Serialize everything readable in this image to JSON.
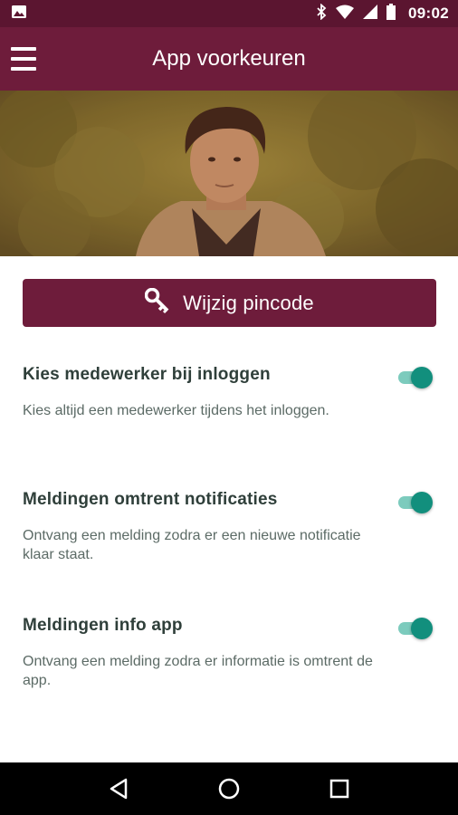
{
  "status_bar": {
    "time": "09:02",
    "icons": [
      "image-icon",
      "bluetooth-icon",
      "wifi-icon",
      "signal-icon",
      "battery-icon"
    ]
  },
  "app_bar": {
    "title": "App voorkeuren",
    "menu_icon": "hamburger-menu-icon"
  },
  "hero": {
    "image": "profile-photo"
  },
  "pin_button": {
    "label": "Wijzig pincode",
    "icon": "key-icon"
  },
  "settings": [
    {
      "title": "Kies medewerker bij inloggen",
      "description": "Kies altijd een medewerker tijdens het inloggen.",
      "enabled": true
    },
    {
      "title": "Meldingen omtrent notificaties",
      "description": "Ontvang een melding zodra er een nieuwe notificatie klaar staat.",
      "enabled": true
    },
    {
      "title": "Meldingen info app",
      "description": "Ontvang een melding zodra er informatie is omtrent de app.",
      "enabled": true
    }
  ],
  "nav_bar": {
    "icons": [
      "back-icon",
      "home-icon",
      "recents-icon"
    ]
  },
  "colors": {
    "primary": "#6e1c3b",
    "status_bar": "#5b1530",
    "toggle_on": "#128f7d",
    "toggle_track": "#7ccbbd",
    "title_text": "#2f3f3a"
  }
}
